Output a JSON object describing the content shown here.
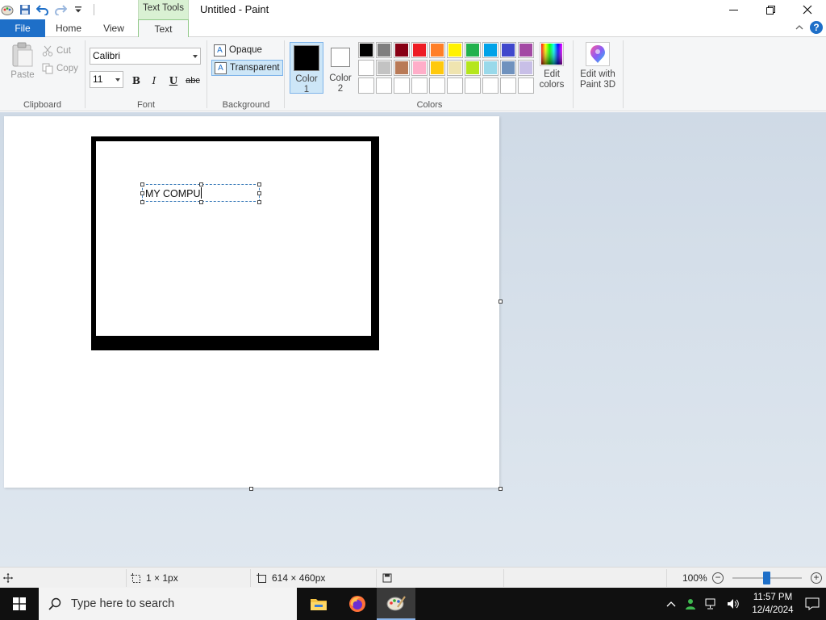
{
  "titlebar": {
    "context_tab_header": "Text Tools",
    "window_title": "Untitled - Paint"
  },
  "tabs": {
    "file": "File",
    "home": "Home",
    "view": "View",
    "text": "Text"
  },
  "ribbon": {
    "clipboard": {
      "paste": "Paste",
      "cut": "Cut",
      "copy": "Copy",
      "label": "Clipboard"
    },
    "font": {
      "family": "Calibri",
      "size": "11",
      "bold": "B",
      "italic": "I",
      "underline": "U",
      "strikethrough": "abc",
      "label": "Font"
    },
    "background": {
      "opaque": "Opaque",
      "transparent": "Transparent",
      "label": "Background"
    },
    "colors": {
      "color1_label": "Color\n1",
      "color1_line1": "Color",
      "color1_line2": "1",
      "color2_line1": "Color",
      "color2_line2": "2",
      "color1_value": "#000000",
      "color2_value": "#ffffff",
      "palette": [
        "#000000",
        "#7f7f7f",
        "#880015",
        "#ed1c24",
        "#ff7f27",
        "#fff200",
        "#22b14c",
        "#00a2e8",
        "#3f48cc",
        "#a349a4",
        "#ffffff",
        "#c3c3c3",
        "#b97a57",
        "#ffaec9",
        "#ffc90e",
        "#efe4b0",
        "#b5e61d",
        "#99d9ea",
        "#7092be",
        "#c8bfe7",
        "",
        "",
        "",
        "",
        "",
        "",
        "",
        "",
        "",
        ""
      ],
      "label": "Colors"
    },
    "edit_colors": {
      "line1": "Edit",
      "line2": "colors"
    },
    "paint3d": {
      "line1": "Edit with",
      "line2": "Paint 3D"
    }
  },
  "canvas": {
    "text_content": "MY COMPU"
  },
  "statusbar": {
    "selection_size": "1 × 1px",
    "canvas_size": "614 × 460px",
    "zoom": "100%"
  },
  "taskbar": {
    "search_placeholder": "Type here to search",
    "time": "11:57 PM",
    "date": "12/4/2024"
  }
}
